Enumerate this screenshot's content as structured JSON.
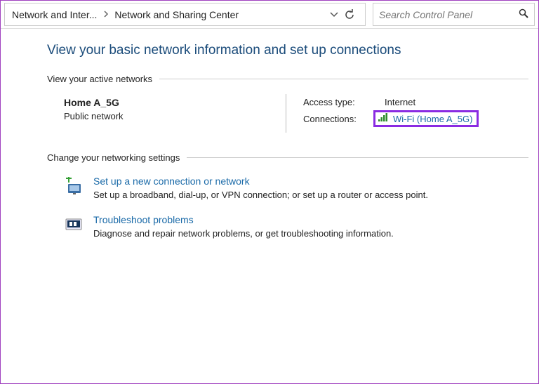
{
  "toolbar": {
    "crumb_parent": "Network and Inter...",
    "crumb_current": "Network and Sharing Center",
    "search_placeholder": "Search Control Panel"
  },
  "page_title": "View your basic network information and set up connections",
  "section_active_label": "View your active networks",
  "network": {
    "name": "Home A_5G",
    "type": "Public network",
    "access_type_label": "Access type:",
    "access_type_value": "Internet",
    "connections_label": "Connections:",
    "connection_link": "Wi-Fi (Home A_5G)"
  },
  "section_settings_label": "Change your networking settings",
  "settings": [
    {
      "link": "Set up a new connection or network",
      "desc": "Set up a broadband, dial-up, or VPN connection; or set up a router or access point."
    },
    {
      "link": "Troubleshoot problems",
      "desc": "Diagnose and repair network problems, or get troubleshooting information."
    }
  ]
}
